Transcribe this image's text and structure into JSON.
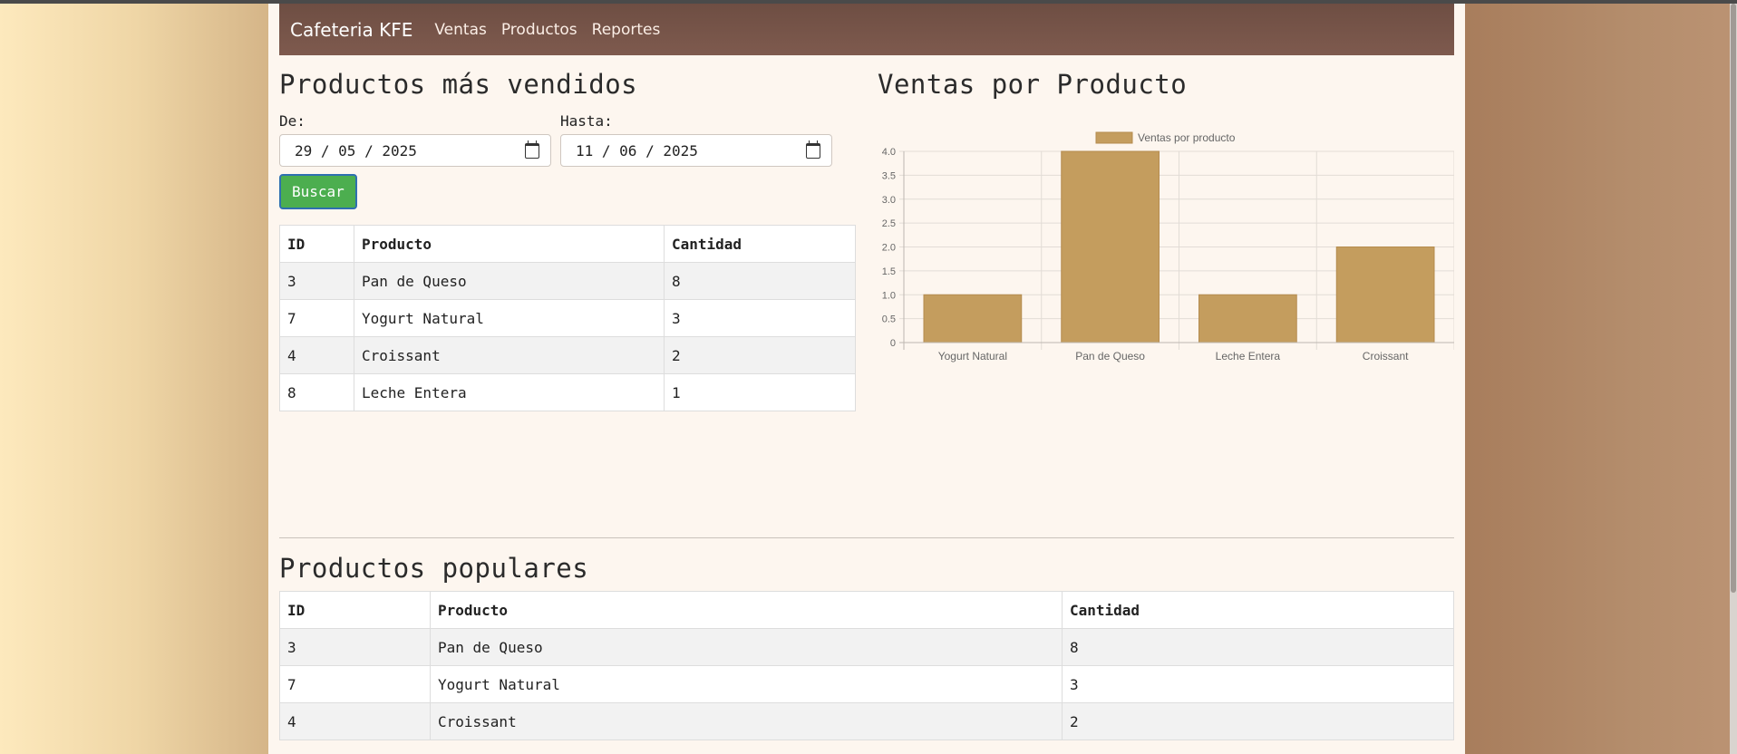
{
  "navbar": {
    "brand": "Cafeteria KFE",
    "links": [
      "Ventas",
      "Productos",
      "Reportes"
    ]
  },
  "best_sellers": {
    "title": "Productos más vendidos",
    "from_label": "De:",
    "from_value": "29 / 05 / 2025",
    "to_label": "Hasta:",
    "to_value": "11 / 06 / 2025",
    "search_button": "Buscar",
    "headers": [
      "ID",
      "Producto",
      "Cantidad"
    ],
    "rows": [
      [
        "3",
        "Pan de Queso",
        "8"
      ],
      [
        "7",
        "Yogurt Natural",
        "3"
      ],
      [
        "4",
        "Croissant",
        "2"
      ],
      [
        "8",
        "Leche Entera",
        "1"
      ]
    ]
  },
  "chart_section": {
    "title": "Ventas por Producto"
  },
  "chart_data": {
    "type": "bar",
    "categories": [
      "Yogurt Natural",
      "Pan de Queso",
      "Leche Entera",
      "Croissant"
    ],
    "series": [
      {
        "name": "Ventas por producto",
        "values": [
          1,
          4,
          1,
          2
        ]
      }
    ],
    "ylim": [
      0,
      4
    ],
    "yticks": [
      "0",
      "0.5",
      "1.0",
      "1.5",
      "2.0",
      "2.5",
      "3.0",
      "3.5",
      "4.0"
    ],
    "legend": "top-center",
    "grid": true,
    "bar_color": "#c49d5e"
  },
  "popular": {
    "title": "Productos populares",
    "headers": [
      "ID",
      "Producto",
      "Cantidad"
    ],
    "rows": [
      [
        "3",
        "Pan de Queso",
        "8"
      ],
      [
        "7",
        "Yogurt Natural",
        "3"
      ],
      [
        "4",
        "Croissant",
        "2"
      ]
    ]
  }
}
